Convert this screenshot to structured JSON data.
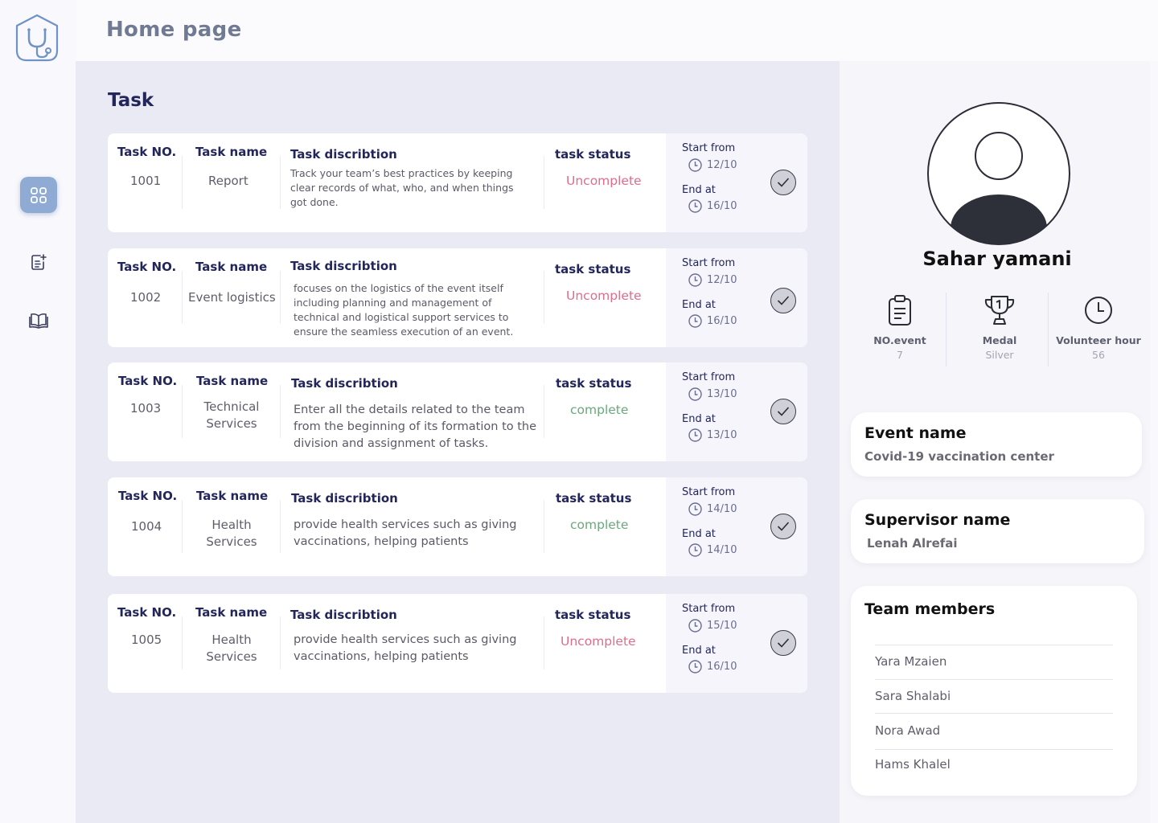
{
  "header": {
    "title": "Home page"
  },
  "sidebar": {
    "items": [
      {
        "name": "dashboard",
        "icon": "grid-icon",
        "active": true
      },
      {
        "name": "add-task",
        "icon": "clipboard-add-icon",
        "active": false
      },
      {
        "name": "guide",
        "icon": "book-icon",
        "active": false
      }
    ]
  },
  "main": {
    "section_title": "Task",
    "labels": {
      "task_no": "Task NO.",
      "task_name": "Task name",
      "task_desc": "Task discribtion",
      "task_status": "task status",
      "start_from": "Start from",
      "end_at": "End at"
    },
    "tasks": [
      {
        "no": "1001",
        "name": "Report",
        "desc": "Track your team’s best practices by keeping clear records of what, who, and when things got done.",
        "status": "Uncomplete",
        "start": "12/10",
        "end": "16/10"
      },
      {
        "no": "1002",
        "name": "Event logistics",
        "desc": "focuses on the logistics of the event itself including planning and management of technical and logistical support services to ensure the seamless execution of an event.",
        "status": "Uncomplete",
        "start": "12/10",
        "end": "16/10"
      },
      {
        "no": "1003",
        "name": "Technical Services",
        "desc": "Enter all the details related to the team from the beginning of its formation to the division and assignment of tasks.",
        "status": "complete",
        "start": "13/10",
        "end": "13/10"
      },
      {
        "no": "1004",
        "name": "Health Services",
        "desc": "provide health services such as giving vaccinations, helping patients",
        "status": "complete",
        "start": "14/10",
        "end": "14/10"
      },
      {
        "no": "1005",
        "name": "Health Services",
        "desc": "provide health services such as giving vaccinations, helping patients",
        "status": "Uncomplete",
        "start": "15/10",
        "end": "16/10"
      }
    ]
  },
  "profile": {
    "name": "Sahar yamani",
    "stats": [
      {
        "label": "NO.event",
        "value": "7",
        "icon": "clipboard-icon"
      },
      {
        "label": "Medal",
        "value": "Silver",
        "icon": "trophy-icon"
      },
      {
        "label": "Volunteer hour",
        "value": "56",
        "icon": "clock-icon"
      }
    ],
    "event": {
      "title": "Event name",
      "value": "Covid-19 vaccination center"
    },
    "supervisor": {
      "title": "Supervisor name",
      "value": "Lenah Alrefai"
    },
    "team": {
      "title": "Team members",
      "members": [
        "Yara Mzaien",
        "Sara Shalabi",
        "Nora Awad",
        "Hams Khalel"
      ]
    }
  },
  "colors": {
    "accent": "#8fabd3",
    "heading": "#23265a",
    "uncomplete": "#e06c8a",
    "complete": "#6aa97b",
    "main_bg": "#e9eaf3"
  }
}
